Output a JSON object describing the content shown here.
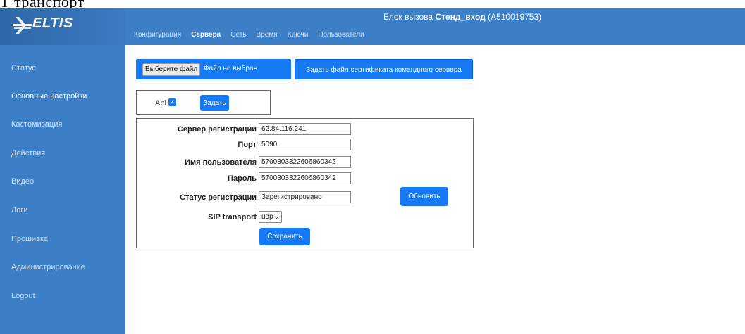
{
  "caption": "Т транспорт",
  "header": {
    "logo_text": "ELTIS",
    "device_prefix": "Блок вызова ",
    "device_name": "Стенд_вход",
    "device_id": " (A510019753)"
  },
  "nav": [
    {
      "label": "Конфигурация"
    },
    {
      "label": "Сервера"
    },
    {
      "label": "Сеть"
    },
    {
      "label": "Время"
    },
    {
      "label": "Ключи"
    },
    {
      "label": "Пользователи"
    }
  ],
  "sidebar": {
    "items": [
      {
        "label": "Статус"
      },
      {
        "label": "Основные настройки"
      },
      {
        "label": "Кастомизация"
      },
      {
        "label": "Действия"
      },
      {
        "label": "Видео"
      },
      {
        "label": "Логи"
      },
      {
        "label": "Прошивка"
      },
      {
        "label": "Администрирование"
      },
      {
        "label": "Logout"
      }
    ]
  },
  "file_upload": {
    "button_label": "Выберите файл",
    "status": "Файл не выбран"
  },
  "cert_button_label": "Задать файл сертификата командного сервера",
  "api": {
    "label": "Api",
    "checked": true,
    "set_label": "Задать"
  },
  "sip": {
    "server_label": "Сервер регистрации",
    "server_value": "62.84.116.241",
    "port_label": "Порт",
    "port_value": "5090",
    "user_label": "Имя пользователя",
    "user_value": "5700303322606860342",
    "password_label": "Пароль",
    "password_value": "5700303322606860342",
    "status_label": "Статус регистрации",
    "status_value": "Зарегистрировано",
    "transport_label": "SIP transport",
    "transport_value": "udp",
    "refresh_label": "Обновить",
    "save_label": "Сохранить"
  }
}
